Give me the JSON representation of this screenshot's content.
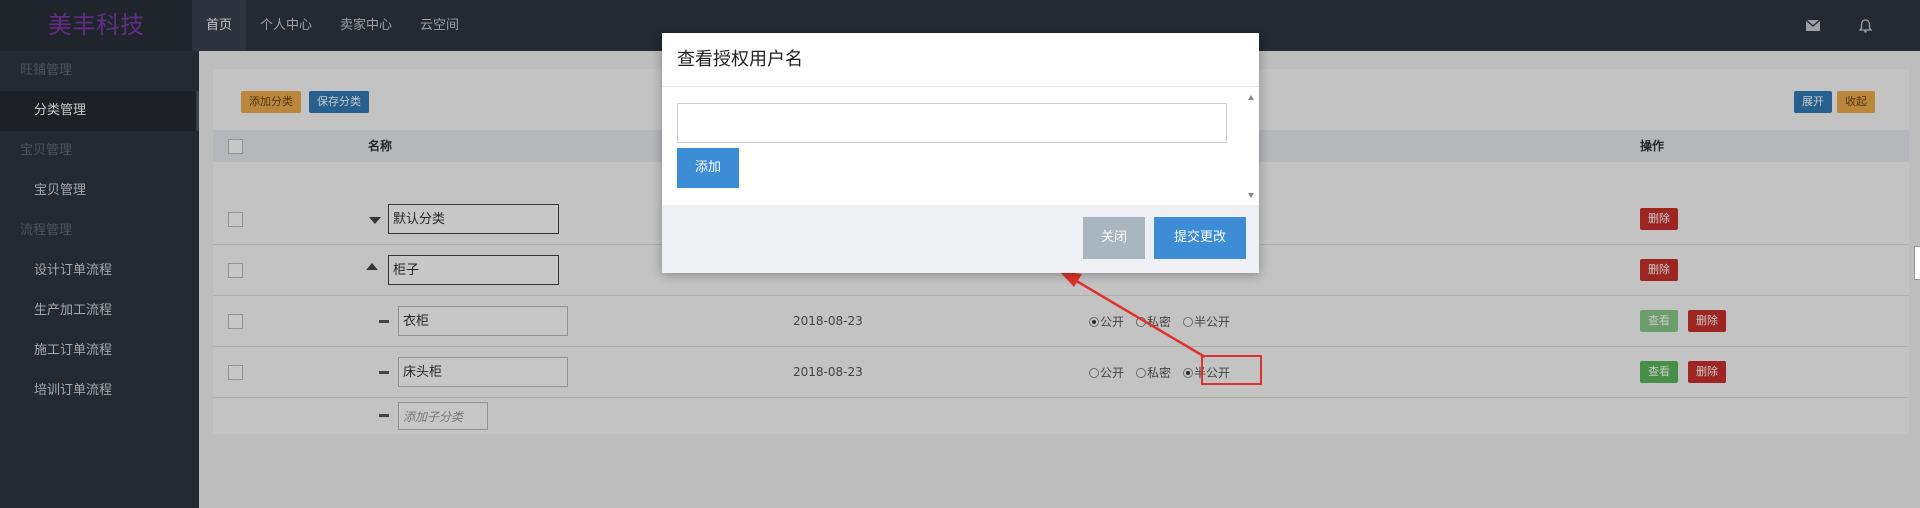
{
  "brand": "美丰科技",
  "nav": {
    "items": [
      "首页",
      "个人中心",
      "卖家中心",
      "云空间"
    ],
    "active_index": 0
  },
  "top_icons": [
    "envelope-icon",
    "bell-icon"
  ],
  "sidebar": {
    "groups": [
      {
        "title": "旺铺管理",
        "items": [
          "分类管理"
        ]
      },
      {
        "title": "宝贝管理",
        "items": [
          "宝贝管理"
        ]
      },
      {
        "title": "流程管理",
        "items": [
          "设计订单流程",
          "生产加工流程",
          "施工订单流程",
          "培训订单流程"
        ]
      }
    ],
    "active_item": "分类管理"
  },
  "toolbar": {
    "add_category": "添加分类",
    "save_category": "保存分类",
    "expand": "展开",
    "collapse": "收起"
  },
  "table": {
    "headers": {
      "name": "名称",
      "actions": "操作"
    },
    "rows": [
      {
        "name": "默认分类",
        "level": "parent",
        "expanded": false,
        "date": "",
        "visibility": "",
        "actions": [
          "删除"
        ]
      },
      {
        "name": "柜子",
        "level": "parent",
        "expanded": true,
        "date": "",
        "visibility": "",
        "actions": [
          "删除"
        ]
      },
      {
        "name": "衣柜",
        "level": "child",
        "date": "2018-08-23",
        "visibility": "公开",
        "actions": [
          "查看",
          "删除"
        ]
      },
      {
        "name": "床头柜",
        "level": "child",
        "date": "2018-08-23",
        "visibility": "半公开",
        "actions": [
          "查看",
          "删除"
        ]
      }
    ],
    "add_child_placeholder": "添加子分类",
    "visibility_options": [
      "公开",
      "私密",
      "半公开"
    ]
  },
  "modal": {
    "title": "查看授权用户名",
    "input_value": "",
    "add_button": "添加",
    "close_button": "关闭",
    "submit_button": "提交更改"
  },
  "colors": {
    "annotation": "#e0322c",
    "primary": "#3c8dd5",
    "danger": "#c9302c",
    "success": "#5cb85c",
    "warning": "#f0ad4e"
  }
}
